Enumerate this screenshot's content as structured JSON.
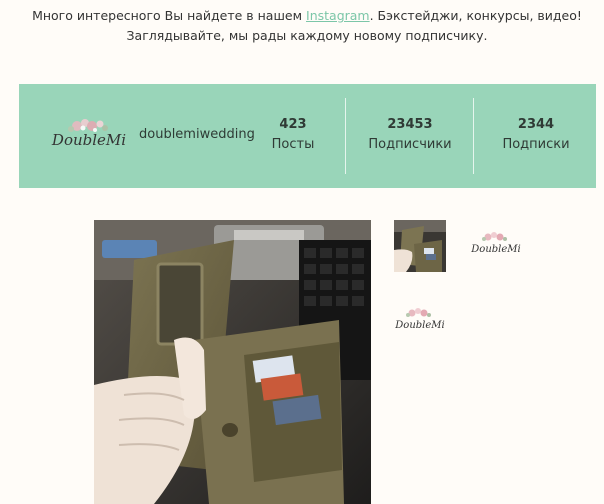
{
  "intro": {
    "line1_before": "Много интересного Вы найдете в нашем ",
    "line1_link": "Instagram",
    "line1_after": ". Бэкстейджи, конкурсы, видео!",
    "line2": "Заглядывайте, мы рады каждому новому подписчику."
  },
  "profile": {
    "logo_text": "DoubleMi",
    "username": "doublemiwedding",
    "stats": [
      {
        "value": "423",
        "label": "Посты"
      },
      {
        "value": "23453",
        "label": "Подписчики"
      },
      {
        "value": "2344",
        "label": "Подписки"
      }
    ]
  },
  "gallery": {
    "thumb_logo_text": "DoubleMi"
  },
  "colors": {
    "bar_bg": "#99d5b9",
    "link": "#7cc6a8",
    "page_bg": "#fffcf8"
  }
}
